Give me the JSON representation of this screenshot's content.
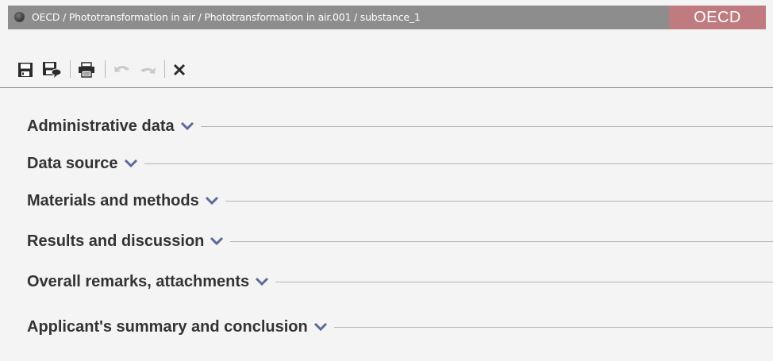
{
  "window": {
    "breadcrumb": "OECD / Phototransformation in air / Phototransformation in air.001 / substance_1",
    "brand_label": "OECD"
  },
  "toolbar": {
    "buttons": [
      {
        "name": "save-button",
        "icon": "floppy-disk-icon",
        "enabled": true
      },
      {
        "name": "save-as-button",
        "icon": "save-as-icon",
        "enabled": true
      },
      {
        "name": "print-button",
        "icon": "printer-icon",
        "enabled": true
      },
      {
        "name": "undo-button",
        "icon": "undo-icon",
        "enabled": false
      },
      {
        "name": "redo-button",
        "icon": "redo-icon",
        "enabled": false
      },
      {
        "name": "close-button",
        "icon": "close-icon",
        "enabled": true
      }
    ]
  },
  "sections": [
    {
      "label": "Administrative data",
      "expand_icon": "chevron-down-icon"
    },
    {
      "label": "Data source",
      "expand_icon": "chevron-down-icon"
    },
    {
      "label": "Materials and methods",
      "expand_icon": "chevron-down-icon"
    },
    {
      "label": "Results and discussion",
      "expand_icon": "chevron-down-icon"
    },
    {
      "label": "Overall remarks, attachments",
      "expand_icon": "chevron-down-icon"
    },
    {
      "label": "Applicant's summary and conclusion",
      "expand_icon": "chevron-down-icon"
    }
  ],
  "colors": {
    "title_bar": "#8d8d8d",
    "brand_badge": "#bf7b7f",
    "background": "#f4f4f4",
    "section_text": "#333333",
    "chevron": "#5c6a9a",
    "disabled_icon": "#c9c9c9"
  }
}
